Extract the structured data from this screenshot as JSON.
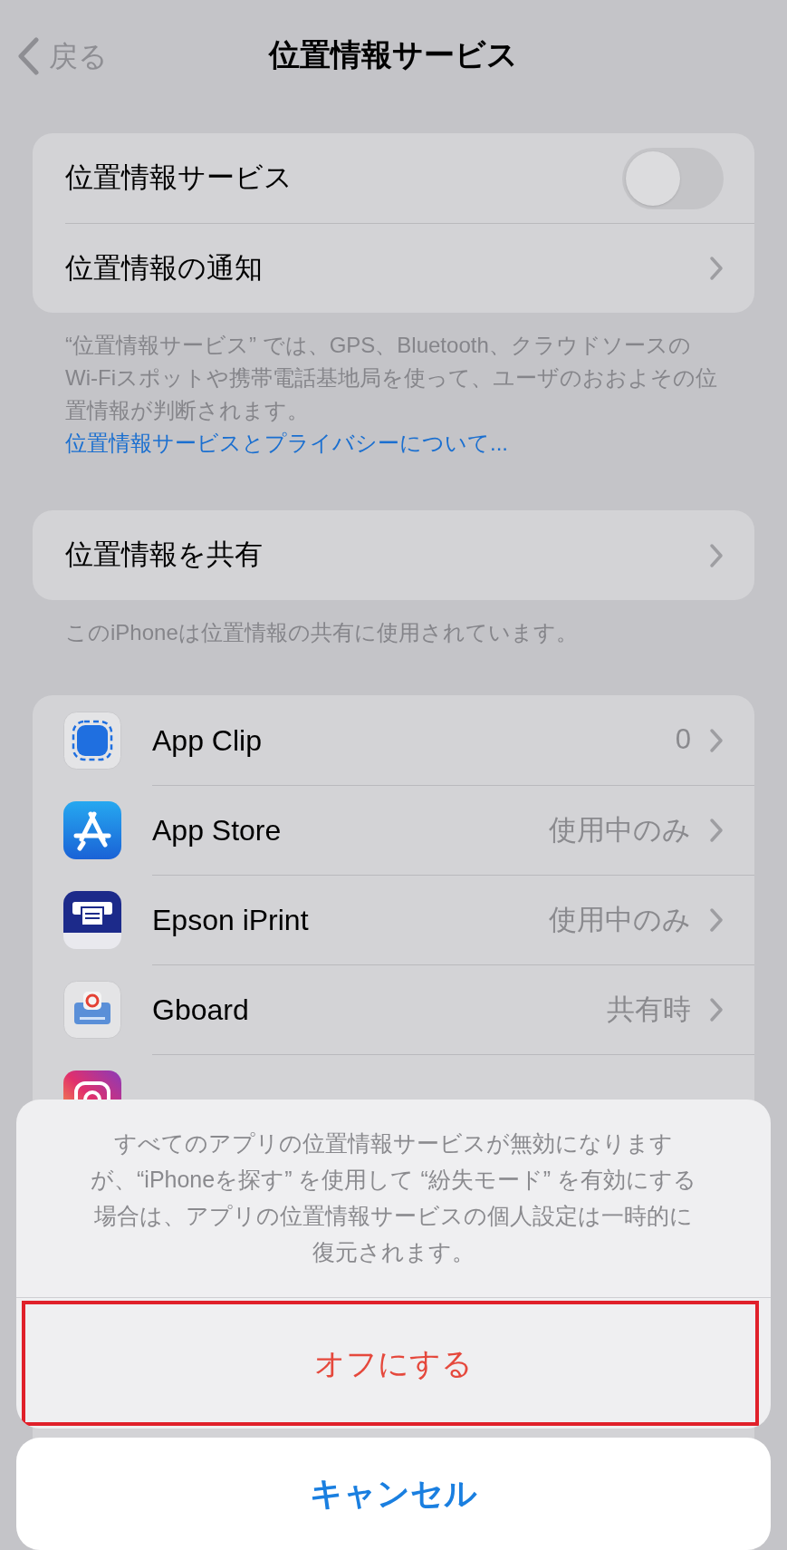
{
  "nav": {
    "back": "戻る",
    "title": "位置情報サービス"
  },
  "sections": [
    {
      "rows": [
        {
          "kind": "toggle",
          "label": "位置情報サービス",
          "on": false
        },
        {
          "kind": "link",
          "label": "位置情報の通知"
        }
      ],
      "footer": {
        "text": "“位置情報サービス” では、GPS、Bluetooth、クラウドソースのWi-Fiスポットや携帯電話基地局を使って、ユーザのおおよその位置情報が判断されます。",
        "link": "位置情報サービスとプライバシーについて..."
      }
    },
    {
      "rows": [
        {
          "kind": "link",
          "label": "位置情報を共有"
        }
      ],
      "footer": {
        "text": "このiPhoneは位置情報の共有に使用されています。"
      }
    }
  ],
  "apps": [
    {
      "name": "App Clip",
      "value": "0"
    },
    {
      "name": "App Store",
      "value": "使用中のみ"
    },
    {
      "name": "Epson iPrint",
      "value": "使用中のみ"
    },
    {
      "name": "Gboard",
      "value": "共有時"
    }
  ],
  "action_sheet": {
    "message": "すべてのアプリの位置情報サービスが無効になりますが、“iPhoneを探す” を使用して “紛失モード” を有効にする場合は、アプリの位置情報サービスの個人設定は一時的に復元されます。",
    "actions": [
      {
        "label": "オフにする",
        "kind": "destructive"
      }
    ],
    "cancel": "キャンセル"
  }
}
